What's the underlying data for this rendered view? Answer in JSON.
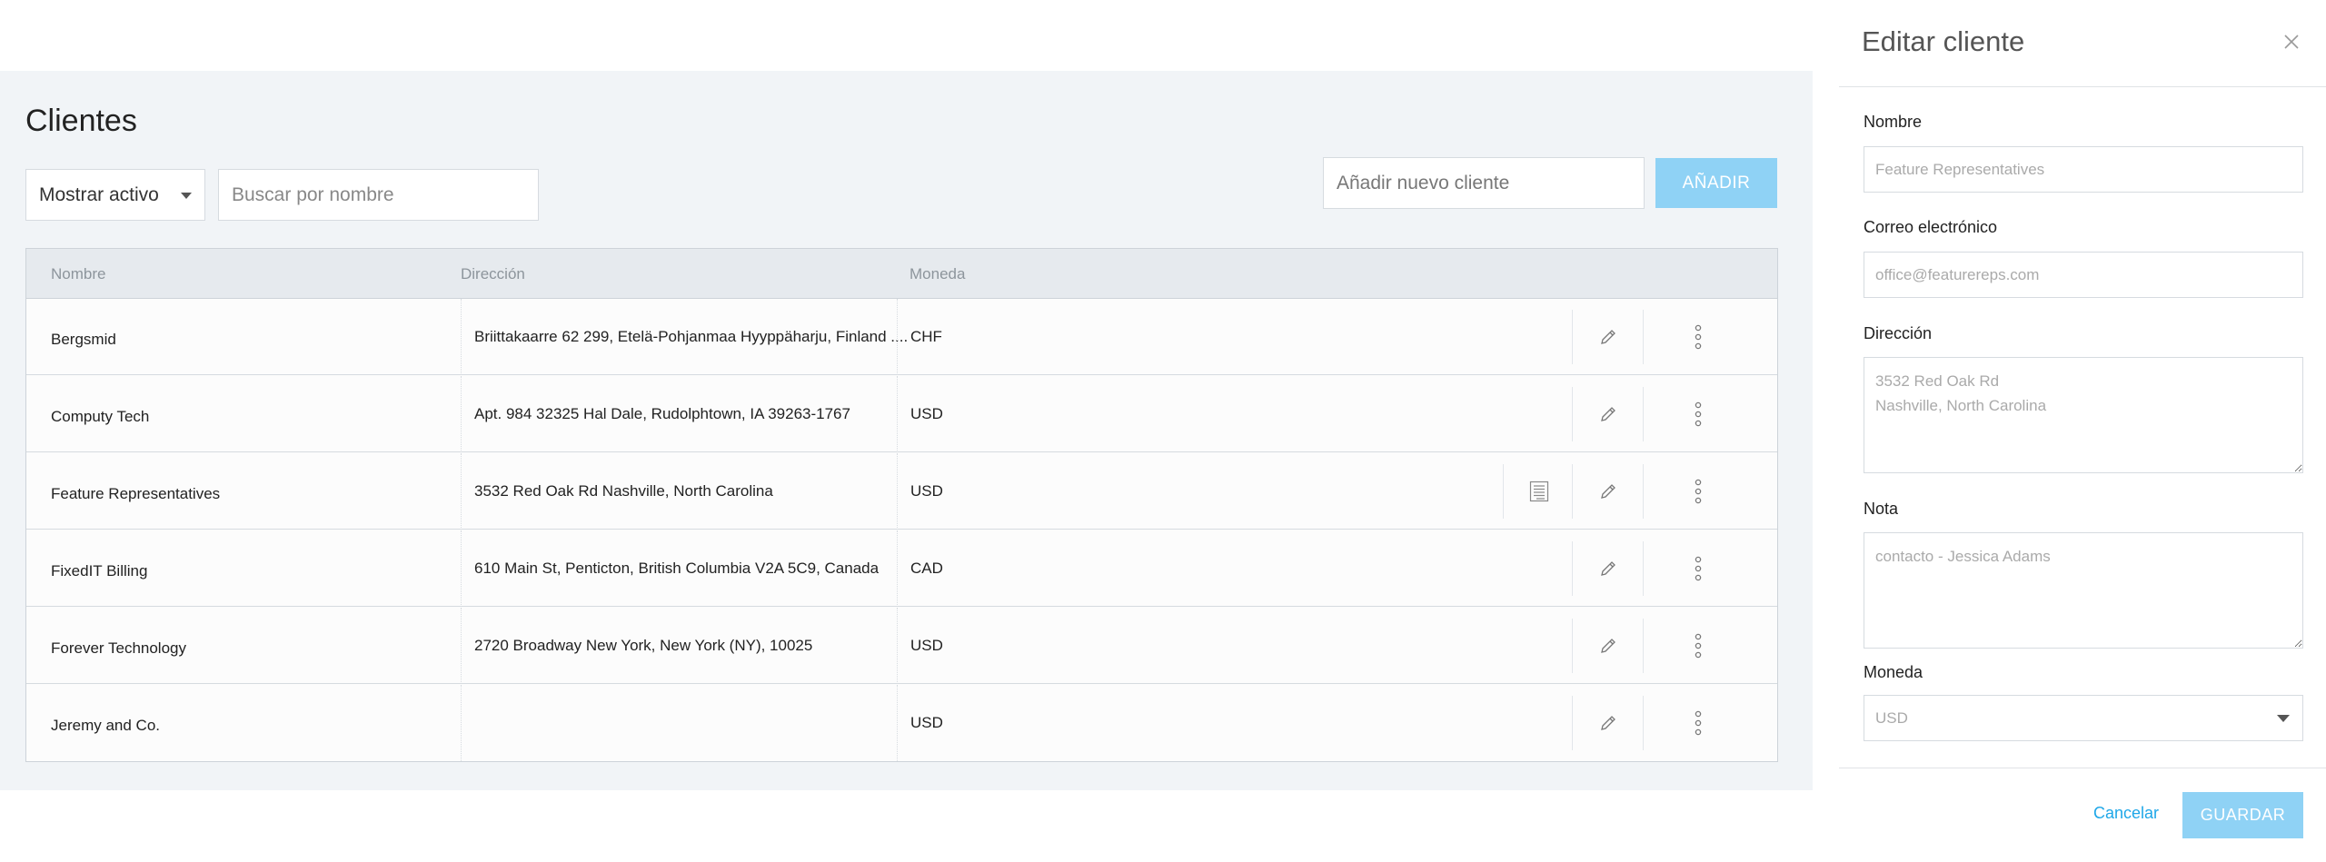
{
  "page": {
    "title": "Clientes",
    "filter_select": "Mostrar activo",
    "search_placeholder": "Buscar por nombre",
    "new_client_placeholder": "Añadir nuevo cliente",
    "add_button": "AÑADIR"
  },
  "table": {
    "columns": [
      "Nombre",
      "Dirección",
      "Moneda"
    ],
    "rows": [
      {
        "name": "Bergsmid",
        "address": "Briittakaarre 62 299, Etelä-Pohjanmaa Hyyppäharju, Finland ....",
        "currency": "CHF",
        "has_invoice_icon": false
      },
      {
        "name": "Computy Tech",
        "address": "Apt. 984 32325 Hal Dale, Rudolphtown, IA 39263-1767",
        "currency": "USD",
        "has_invoice_icon": false
      },
      {
        "name": "Feature Representatives",
        "address": "3532 Red Oak Rd Nashville, North Carolina",
        "currency": "USD",
        "has_invoice_icon": true
      },
      {
        "name": "FixedIT Billing",
        "address": "610 Main St, Penticton, British Columbia V2A 5C9, Canada",
        "currency": "CAD",
        "has_invoice_icon": false
      },
      {
        "name": "Forever Technology",
        "address": "2720 Broadway New York, New York (NY), 10025",
        "currency": "USD",
        "has_invoice_icon": false
      },
      {
        "name": "Jeremy and Co.",
        "address": "",
        "currency": "USD",
        "has_invoice_icon": false
      }
    ]
  },
  "drawer": {
    "title": "Editar cliente",
    "name_label": "Nombre",
    "name_placeholder": "Feature Representatives",
    "email_label": "Correo electrónico",
    "email_placeholder": "office@featurereps.com",
    "address_label": "Dirección",
    "address_placeholder": "3532 Red Oak Rd\nNashville, North Carolina",
    "note_label": "Nota",
    "note_placeholder": "contacto - Jessica Adams",
    "currency_label": "Moneda",
    "currency_value": "USD",
    "cancel_label": "Cancelar",
    "save_label": "GUARDAR"
  },
  "colors": {
    "accent": "#1ea7e8",
    "button_disabled": "#8fd2f5",
    "page_background": "#f1f4f7",
    "table_header": "#e6eaee"
  },
  "icons": [
    "pencil-icon",
    "kebab-menu-icon",
    "invoice-list-icon",
    "close-icon",
    "chevron-down-icon"
  ]
}
